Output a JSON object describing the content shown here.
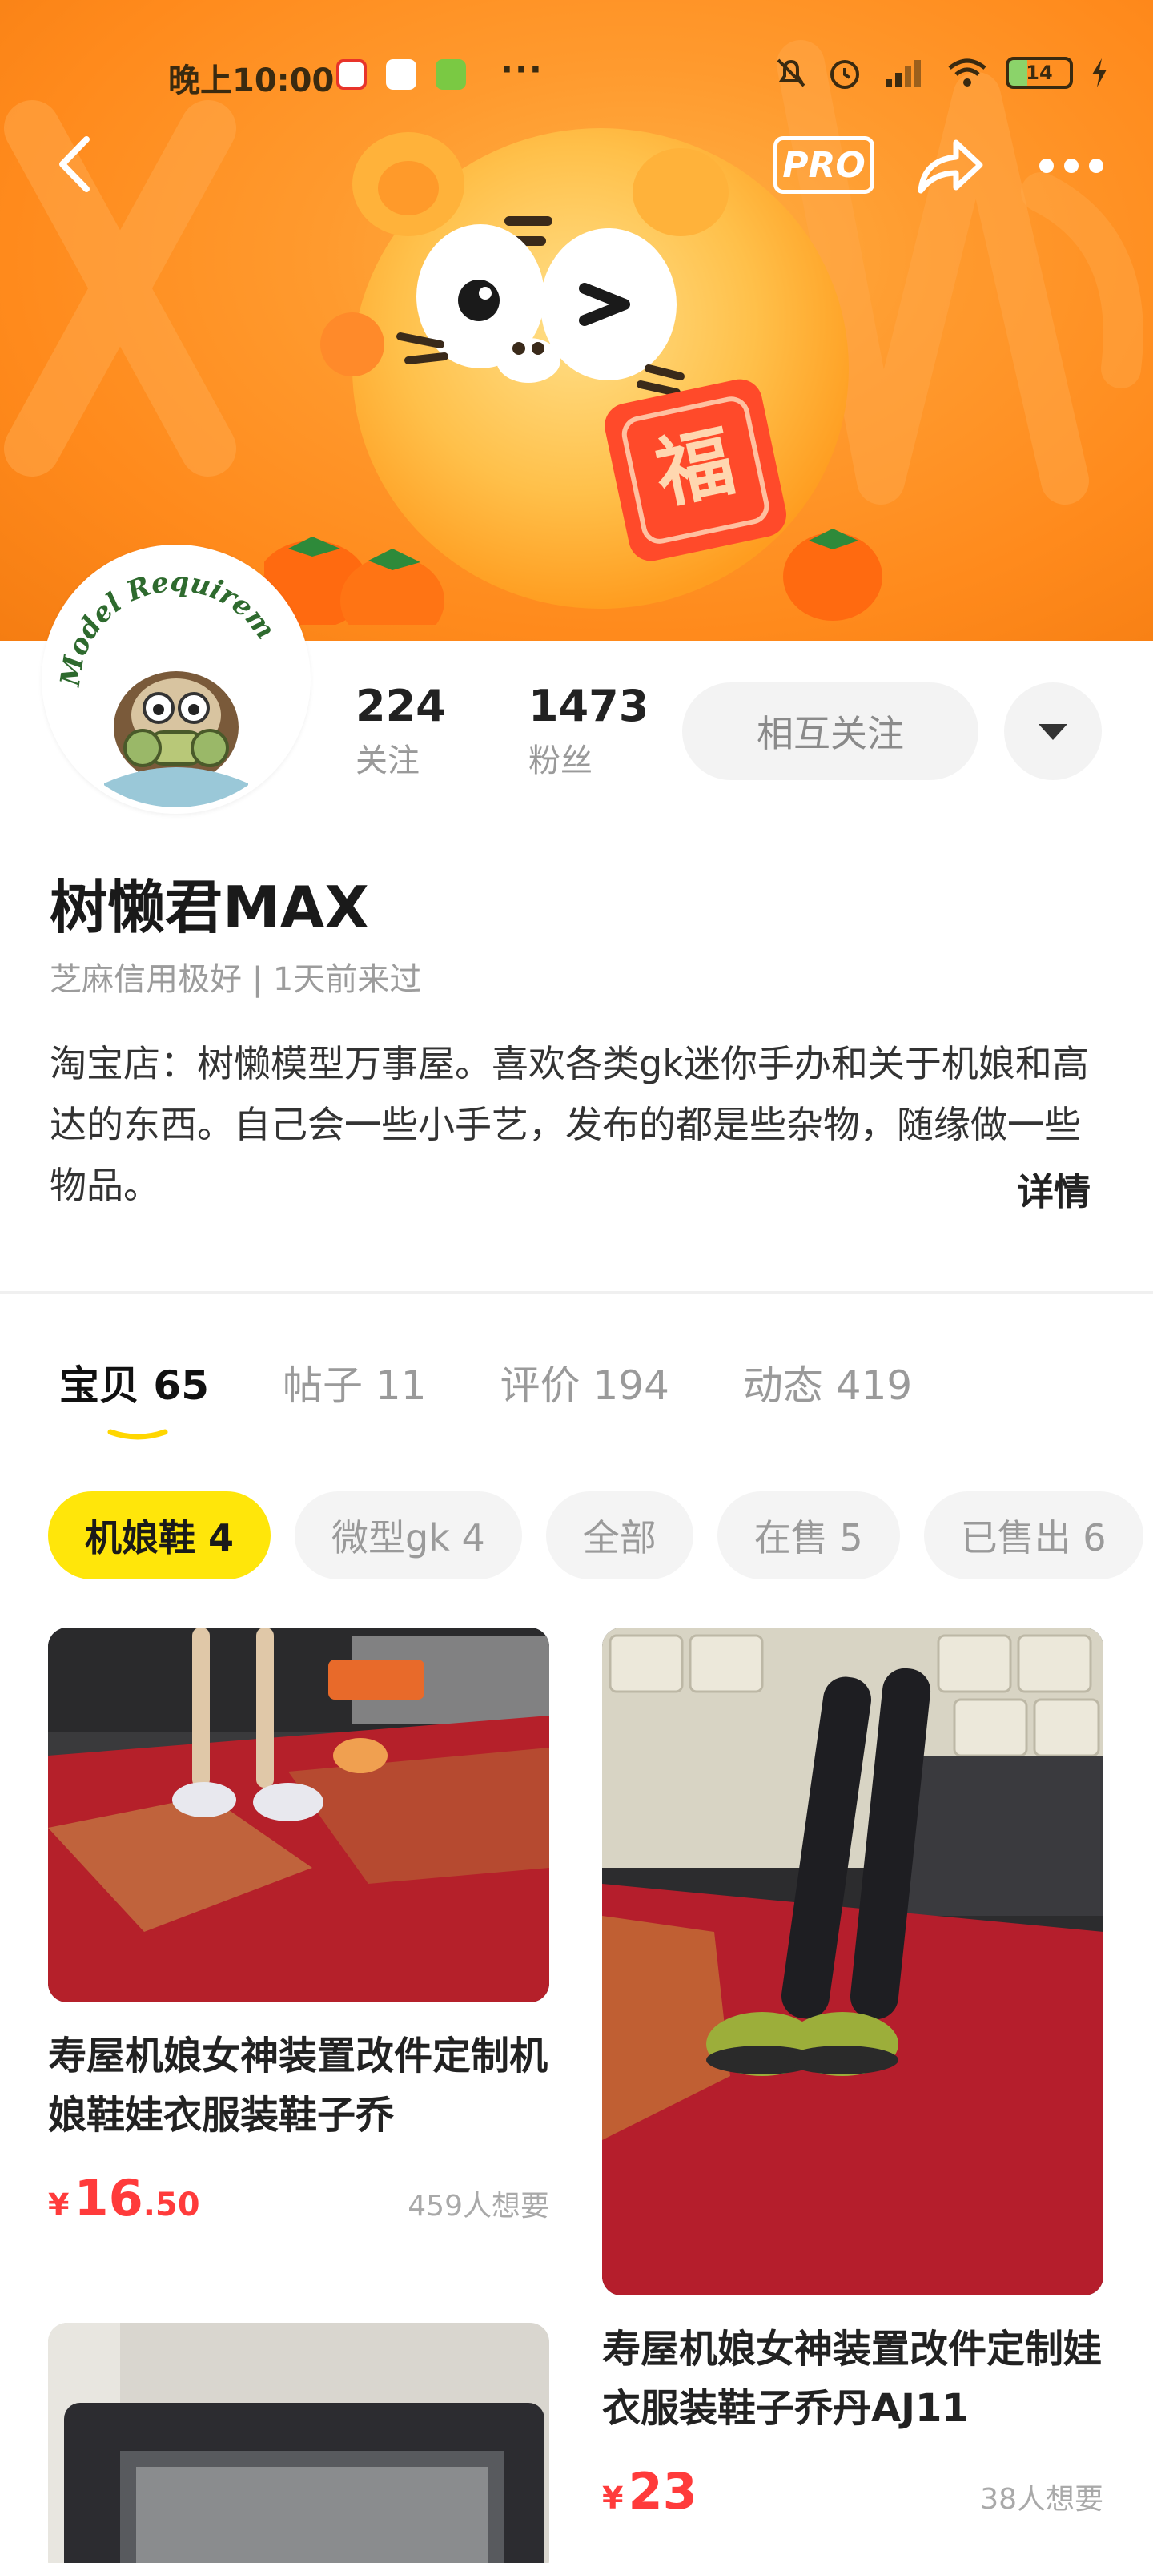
{
  "status_bar": {
    "time": "晚上10:00",
    "more": "···",
    "battery": "14"
  },
  "nav": {
    "pro_label": "PRO"
  },
  "profile": {
    "avatar_text": "Model Requirem",
    "following_count": "224",
    "following_label": "关注",
    "fans_count": "1473",
    "fans_label": "粉丝",
    "mutual_button": "相互关注",
    "name": "树懒君MAX",
    "meta": "芝麻信用极好 | 1天前来过",
    "bio": "淘宝店：树懒模型万事屋。喜欢各类gk迷你手办和关于机娘和高达的东西。自己会一些小手艺，发布的都是些杂物，随缘做一些物品。",
    "detail_link": "详情"
  },
  "tabs": [
    {
      "label": "宝贝",
      "count": "65",
      "active": true
    },
    {
      "label": "帖子",
      "count": "11"
    },
    {
      "label": "评价",
      "count": "194"
    },
    {
      "label": "动态",
      "count": "419"
    }
  ],
  "chips": [
    {
      "label": "机娘鞋 4",
      "active": true
    },
    {
      "label": "微型gk 4"
    },
    {
      "label": "全部"
    },
    {
      "label": "在售 5"
    },
    {
      "label": "已售出 6"
    }
  ],
  "products": [
    {
      "title": "寿屋机娘女神装置改件定制机娘鞋娃衣服装鞋子乔",
      "currency": "¥",
      "price_int": "16",
      "price_dec": ".50",
      "want": "459人想要"
    },
    {
      "title": "寿屋机娘女神装置改件定制娃衣服装鞋子乔丹AJ11",
      "currency": "¥",
      "price_int": "23",
      "price_dec": "",
      "want": "38人想要"
    }
  ],
  "colors": {
    "banner": "#ff9a2e",
    "accent_yellow": "#ffe60a",
    "price_red": "#ff3b3b"
  }
}
